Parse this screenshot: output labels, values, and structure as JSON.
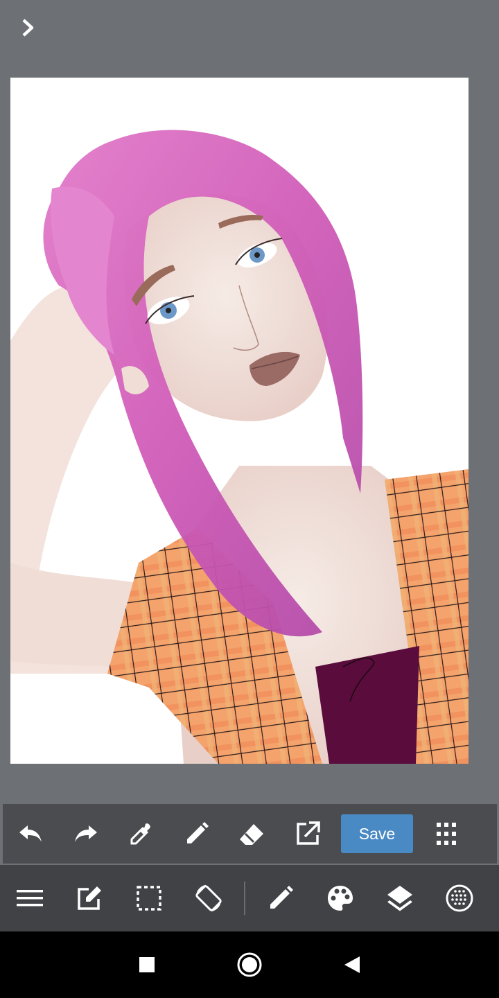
{
  "toolbar": {
    "save_label": "Save",
    "icons": [
      "undo-icon",
      "redo-icon",
      "eyedropper-icon",
      "pencil-icon",
      "eraser-icon",
      "export-icon",
      "grid-icon"
    ]
  },
  "bottom_toolbar": {
    "icons": [
      "menu-icon",
      "edit-icon",
      "selection-icon",
      "rotate-screen-icon",
      "brush-icon",
      "palette-icon",
      "layers-icon",
      "texture-icon"
    ]
  },
  "navbar": {
    "icons": [
      "recents-icon",
      "home-icon",
      "back-icon"
    ]
  },
  "colors": {
    "background": "#6d7176",
    "toolbar": "#4a4c50",
    "bottom_toolbar": "#404246",
    "save_button": "#4a8ac4",
    "hair": "#d85fb8",
    "shirt": "#f4a06a",
    "top": "#5a0c3c"
  }
}
